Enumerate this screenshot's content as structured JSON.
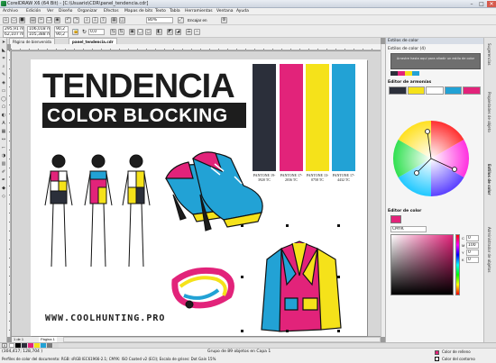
{
  "window": {
    "title": "CorelDRAW X6 (64 Bit) - [C:\\Usuario\\CDR\\panel_tendencia.cdr]",
    "minimize": "–",
    "maximize": "□",
    "close": "✕"
  },
  "menu": [
    "Archivo",
    "Edición",
    "Ver",
    "Diseño",
    "Organizar",
    "Efectos",
    "Mapas de bits",
    "Texto",
    "Tabla",
    "Herramientas",
    "Ventana",
    "Ayuda"
  ],
  "toolbar": {
    "zoom": "80%",
    "snap": "Encajar en"
  },
  "propbar": {
    "paper": "A4",
    "width": "210,0 mm",
    "height": "297,0 mm",
    "x": "295,91 mm",
    "y": "62,107 mm",
    "w": "106,018 mm",
    "h": "105,388 mm",
    "scale_x": "90,2",
    "scale_y": "90,2",
    "angle": "0,0"
  },
  "tabs": [
    "Página de bienvenida",
    "panel_tendencia.cdr"
  ],
  "pagenav": {
    "page": "1 de 1",
    "page_tab": "Página 1"
  },
  "artwork": {
    "headline": "TENDENCIA",
    "subhead": "COLOR BLOCKING",
    "url": "WWW.COOLHUNTING.PRO",
    "pantone": [
      {
        "label": "PANTONE 19-3920 TC",
        "color": "#2b2f3a"
      },
      {
        "label": "PANTONE 17-2036 TC",
        "color": "#e2237a"
      },
      {
        "label": "PANTONE 13-0758 TC",
        "color": "#f5e21a"
      },
      {
        "label": "PANTONE 17-4432 TC",
        "color": "#22a2d5"
      }
    ]
  },
  "docker": {
    "title": "Estilos de color",
    "styles_label": "Estilos de color (4)",
    "drag_hint": "Arrastre hasta aquí para añadir un estilo de color",
    "harmony_label": "Editor de armonías",
    "color_editor_label": "Editor de color",
    "model": "CMYK",
    "harmony_swatches": [
      "#2b2f3a",
      "#f5e21a",
      "#ffffff",
      "#22a2d5",
      "#e2237a"
    ],
    "channels": [
      {
        "name": "C",
        "value": "0"
      },
      {
        "name": "M",
        "value": "100"
      },
      {
        "name": "Y",
        "value": "0"
      },
      {
        "name": "K",
        "value": "0"
      }
    ],
    "side_tabs": [
      "Sugerencias",
      "Propiedades de objeto",
      "Estilos de color",
      "Administrador de objetos"
    ]
  },
  "status": {
    "coords": "(304,417; 128,704 )",
    "selection": "Grupo de 89 objetos en Capa 1",
    "profile": "Perfiles de color del documento: RGB: sRGB IEC61966-2.1; CMYK: ISO Coated v2 (ECI); Escala de grises: Dot Gain 15%",
    "fill_label": "Color de relleno",
    "outline_label": "Color del contorno"
  },
  "palette": [
    "#ffffff",
    "#000000",
    "#2b2f3a",
    "#e2237a",
    "#f5e21a",
    "#22a2d5",
    "#7a7a7a",
    "#d9d9d9",
    "#e8322d",
    "#2e9b45",
    "#8c3aa8",
    "#f39222",
    "#6b3a1f",
    "#bde0f6"
  ]
}
